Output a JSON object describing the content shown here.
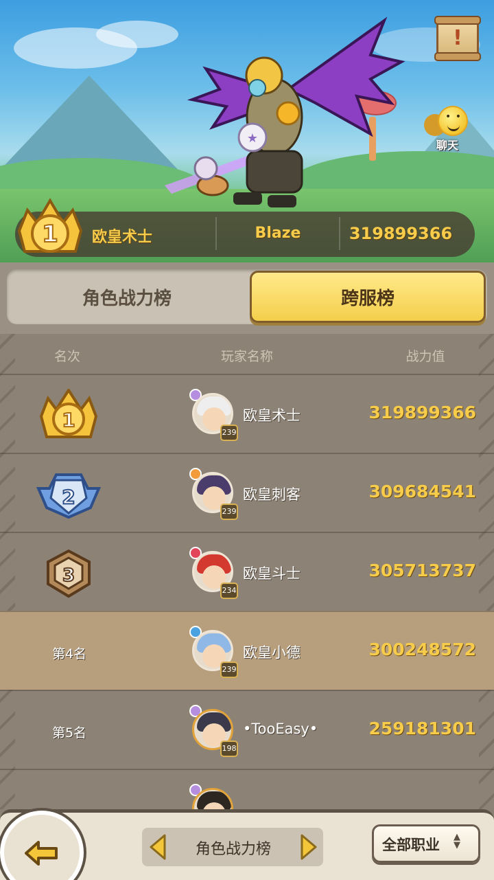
{
  "top_banner": {
    "rank": "1",
    "name": "欧皇术士",
    "server": "Blaze",
    "power": "319899366"
  },
  "chat_button": {
    "label": "聊天",
    "icon": "chat-bubble-icon"
  },
  "notice_button": {
    "icon": "scroll-notice-icon",
    "mark": "!"
  },
  "tabs": [
    {
      "label": "角色战力榜",
      "active": false
    },
    {
      "label": "跨服榜",
      "active": true
    }
  ],
  "table": {
    "headers": {
      "rank": "名次",
      "player": "玩家名称",
      "power": "战力值"
    },
    "rows": [
      {
        "rank": "1",
        "rank_text": "",
        "name": "欧皇术士",
        "level": "239",
        "power": "319899366",
        "highlight": false
      },
      {
        "rank": "2",
        "rank_text": "",
        "name": "欧皇刺客",
        "level": "239",
        "power": "309684541",
        "highlight": false
      },
      {
        "rank": "3",
        "rank_text": "",
        "name": "欧皇斗士",
        "level": "234",
        "power": "305713737",
        "highlight": false
      },
      {
        "rank": "4",
        "rank_text": "第4名",
        "name": "欧皇小德",
        "level": "239",
        "power": "300248572",
        "highlight": true
      },
      {
        "rank": "5",
        "rank_text": "第5名",
        "name": "•TooEasy•",
        "level": "198",
        "power": "259181301",
        "highlight": false
      }
    ]
  },
  "bottom": {
    "back_icon": "back-arrow-icon",
    "selector_label": "角色战力榜",
    "job_filter_label": "全部职业"
  },
  "colors": {
    "gold_text": "#f6cc4a",
    "active_tab": "#f4cf4c",
    "highlight_row": "#b79f7e",
    "table_bg": "#8c8275"
  }
}
